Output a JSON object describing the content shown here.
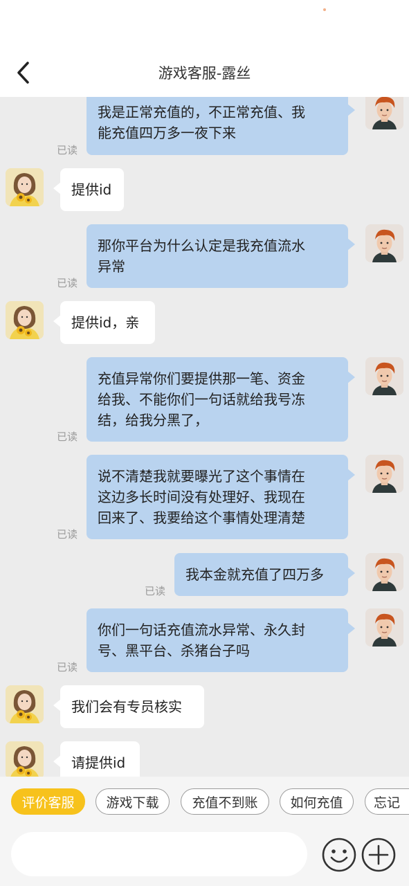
{
  "header": {
    "title": "游戏客服-露丝",
    "back_icon": "chevron-left-icon"
  },
  "read_label": "已读",
  "messages": [
    {
      "from": "user",
      "text": "我是正常充值的，不正常充值、我\n能充值四万多一夜下来",
      "read": "已读"
    },
    {
      "from": "agent",
      "text": "提供id"
    },
    {
      "from": "user",
      "text": "那你平台为什么认定是我充值流水\n异常",
      "read": "已读"
    },
    {
      "from": "agent",
      "text": "提供id，亲"
    },
    {
      "from": "user",
      "text": "充值异常你们要提供那一笔、资金\n给我、不能你们一句话就给我号冻\n结，给我分黑了，",
      "read": "已读"
    },
    {
      "from": "user",
      "text": "说不清楚我就要曝光了这个事情在\n这边多长时间没有处理好、我现在\n回来了、我要给这个事情处理清楚",
      "read": "已读"
    },
    {
      "from": "user",
      "text": "我本金就充值了四万多",
      "read": "已读"
    },
    {
      "from": "user",
      "text": "你们一句话充值流水异常、永久封\n号、黑平台、杀猪台子吗",
      "read": "已读"
    },
    {
      "from": "agent",
      "text": "我们会有专员核实"
    },
    {
      "from": "agent",
      "text": "请提供id"
    }
  ],
  "quick_replies": [
    "评价客服",
    "游戏下载",
    "充值不到账",
    "如何充值",
    "忘记"
  ],
  "input": {
    "placeholder": "",
    "emoji_icon": "smiley-icon",
    "add_icon": "plus-circle-icon"
  },
  "colors": {
    "user_bubble": "#b9d3ef",
    "agent_bubble": "#ffffff",
    "accent": "#f7c21c",
    "background": "#ececec"
  }
}
